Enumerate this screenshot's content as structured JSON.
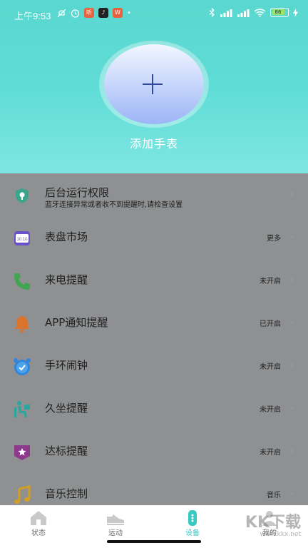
{
  "status_bar": {
    "time": "上午9:53",
    "battery": "86",
    "left_icons": [
      "mute-icon",
      "alarm-icon",
      "app-icon-1",
      "tiktok-icon",
      "app-icon-2",
      "dot-icon"
    ],
    "right_icons": [
      "bluetooth-icon",
      "signal-icon-1",
      "signal-icon-2",
      "wifi-icon",
      "battery-icon",
      "charging-icon"
    ]
  },
  "header": {
    "add_label": "添加手表",
    "gradient_colors": [
      "#5ad7cf",
      "#7fe6e2"
    ]
  },
  "settings": [
    {
      "id": "background",
      "label": "后台运行权限",
      "sub": "蓝牙连接异常或者收不到提醒时,请检查设置",
      "value": "",
      "icon": "shield-icon",
      "icon_color": "#3aa58a"
    },
    {
      "id": "watchface",
      "label": "表盘市场",
      "value": "更多",
      "icon": "watchface-icon",
      "icon_color": "#6a51c8"
    },
    {
      "id": "call",
      "label": "来电提醒",
      "value": "未开启",
      "icon": "phone-icon",
      "icon_color": "#3fa54e"
    },
    {
      "id": "app",
      "label": "APP通知提醒",
      "value": "已开启",
      "icon": "bell-icon",
      "icon_color": "#d9732e"
    },
    {
      "id": "alarm",
      "label": "手环闹钟",
      "value": "未开启",
      "icon": "alarm-clock-icon",
      "icon_color": "#2f86d9"
    },
    {
      "id": "sedentary",
      "label": "久坐提醒",
      "value": "未开启",
      "icon": "sitting-icon",
      "icon_color": "#2aa69c"
    },
    {
      "id": "goal",
      "label": "达标提醒",
      "value": "未开启",
      "icon": "badge-icon",
      "icon_color": "#8e3a8c"
    },
    {
      "id": "music",
      "label": "音乐控制",
      "value": "音乐",
      "icon": "music-icon",
      "icon_color": "#d1a021"
    }
  ],
  "bottom_nav": [
    {
      "label": "状态",
      "icon": "home-icon",
      "active": false
    },
    {
      "label": "运动",
      "icon": "shoe-icon",
      "active": false
    },
    {
      "label": "设备",
      "icon": "band-icon",
      "active": true
    },
    {
      "label": "我的",
      "icon": "person-icon",
      "active": false
    }
  ],
  "accent_color": "#38c9c1",
  "watermark": {
    "title": "KK下载",
    "url": "www.kkx.net"
  }
}
